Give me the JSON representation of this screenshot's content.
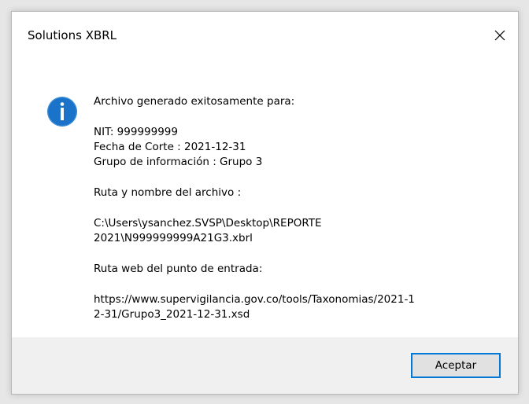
{
  "window": {
    "title": "Solutions XBRL",
    "close_icon": "close-icon"
  },
  "message": {
    "icon": "info-icon",
    "heading": "Archivo generado exitosamente para:",
    "nit": "NIT: 999999999",
    "fecha": "Fecha de Corte : 2021-12-31",
    "grupo": "Grupo de información : Grupo 3",
    "ruta_label": "Ruta y nombre del archivo :",
    "ruta_line1": "C:\\Users\\ysanchez.SVSP\\Desktop\\REPORTE",
    "ruta_line2": "2021\\N999999999A21G3.xbrl",
    "web_label": "Ruta web del punto de entrada:",
    "web_line1": "https://www.supervigilancia.gov.co/tools/Taxonomias/2021-1",
    "web_line2": "2-31/Grupo3_2021-12-31.xsd"
  },
  "footer": {
    "ok_label": "Aceptar"
  },
  "colors": {
    "info_blue": "#1a73c8",
    "button_border": "#0078d7",
    "footer_bg": "#f0f0f0"
  }
}
